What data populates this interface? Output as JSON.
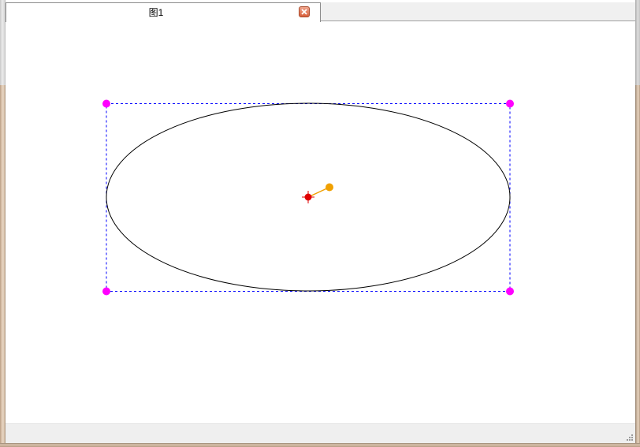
{
  "tabs": [
    {
      "label": "图1",
      "active": true
    }
  ],
  "shape": {
    "type": "ellipse",
    "selected": true,
    "stroke_color": "#000000",
    "selection_box_color": "#0000ff",
    "handle_color": "#ff00ff",
    "center_marker_color": "#ff0000",
    "rotation_handle_color": "#f0a000"
  },
  "icons": {
    "tab_close": "close-icon",
    "resize_grip": "resize-grip-icon",
    "center_marker": "crosshair-icon"
  }
}
